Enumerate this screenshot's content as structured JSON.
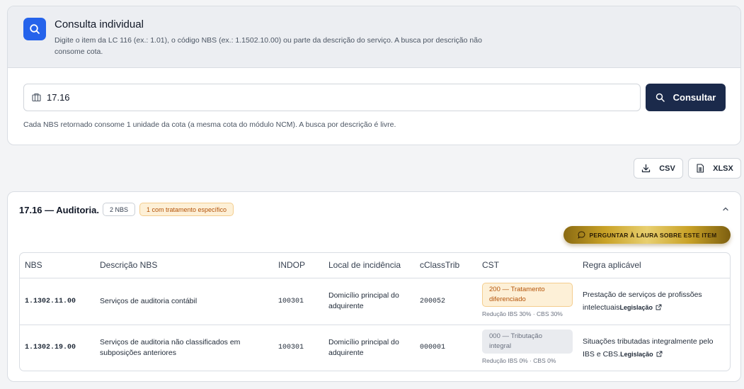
{
  "search": {
    "title": "Consulta individual",
    "subtitle": "Digite o item da LC 116 (ex.: 1.01), o código NBS (ex.: 1.1502.10.00) ou parte da descrição do serviço. A busca por descrição não consome cota.",
    "input_value": "17.16",
    "button_label": "Consultar",
    "hint": "Cada NBS retornado consome 1 unidade da cota (a mesma cota do módulo NCM). A busca por descrição é livre."
  },
  "export": {
    "csv_label": "CSV",
    "xlsx_label": "XLSX"
  },
  "result": {
    "title": "17.16 — Auditoria.",
    "count_badge": "2 NBS",
    "special_badge": "1 com tratamento específico",
    "ask_button": "PERGUNTAR À LAURA SOBRE ESTE ITEM",
    "columns": [
      "NBS",
      "Descrição NBS",
      "INDOP",
      "Local de incidência",
      "cClassTrib",
      "CST",
      "Regra aplicável"
    ],
    "rows": [
      {
        "nbs": "1.1302.11.00",
        "descricao": "Serviços de auditoria contábil",
        "indop": "100301",
        "local": "Domicílio principal do adquirente",
        "cclasstrib": "200052",
        "cst": "200 — Tratamento diferenciado",
        "cst_note": "Redução IBS 30% · CBS 30%",
        "regra": "Prestação de serviços de profissões intelectuais",
        "link": "Legislação"
      },
      {
        "nbs": "1.1302.19.00",
        "descricao": "Serviços de auditoria não classificados em subposições anteriores",
        "indop": "100301",
        "local": "Domicílio principal do adquirente",
        "cclasstrib": "000001",
        "cst": "000 — Tributação integral",
        "cst_note": "Redução IBS 0% · CBS 0%",
        "regra": "Situações tributadas integralmente pelo IBS e CBS.",
        "link": "Legislação"
      }
    ]
  },
  "icons": {
    "search_badge": "search-icon",
    "input_icon": "building-icon",
    "button_icon": "search-icon",
    "csv_icon": "download-icon",
    "xlsx_icon": "spreadsheet-icon",
    "collapse": "chevron-up-icon",
    "ask_icon": "chat-bubble-icon",
    "link_icon": "external-link-icon"
  },
  "colors": {
    "primary_blue": "#2563eb",
    "navy": "#1b2a4b",
    "amber_text": "#b45309",
    "amber_bg": "#fdf0d7",
    "gold": "#c9a227"
  }
}
